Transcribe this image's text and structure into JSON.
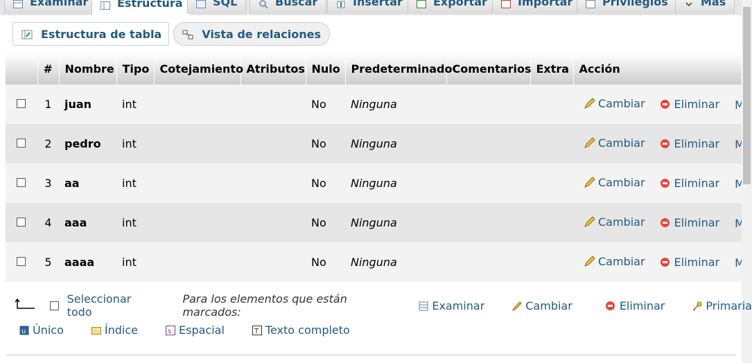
{
  "tabs": [
    {
      "label": "Examinar",
      "icon": "table-icon"
    },
    {
      "label": "Estructura",
      "icon": "structure-icon",
      "active": true
    },
    {
      "label": "SQL",
      "icon": "sql-icon"
    },
    {
      "label": "Buscar",
      "icon": "search-icon"
    },
    {
      "label": "Insertar",
      "icon": "insert-icon"
    },
    {
      "label": "Exportar",
      "icon": "export-icon"
    },
    {
      "label": "Importar",
      "icon": "import-icon"
    },
    {
      "label": "Privilegios",
      "icon": "privileges-icon"
    },
    {
      "label": "Más",
      "icon": "chevron-down-icon"
    }
  ],
  "subnav": {
    "table_structure": "Estructura de tabla",
    "relation_view": "Vista de relaciones"
  },
  "columns": [
    "",
    "#",
    "Nombre",
    "Tipo",
    "Cotejamiento",
    "Atributos",
    "Nulo",
    "Predeterminado",
    "Comentarios",
    "Extra",
    "Acción"
  ],
  "rows": [
    {
      "num": "1",
      "name": "juan",
      "type": "int",
      "collation": "",
      "attributes": "",
      "null": "No",
      "default": "Ninguna",
      "comments": "",
      "extra": ""
    },
    {
      "num": "2",
      "name": "pedro",
      "type": "int",
      "collation": "",
      "attributes": "",
      "null": "No",
      "default": "Ninguna",
      "comments": "",
      "extra": ""
    },
    {
      "num": "3",
      "name": "aa",
      "type": "int",
      "collation": "",
      "attributes": "",
      "null": "No",
      "default": "Ninguna",
      "comments": "",
      "extra": ""
    },
    {
      "num": "4",
      "name": "aaa",
      "type": "int",
      "collation": "",
      "attributes": "",
      "null": "No",
      "default": "Ninguna",
      "comments": "",
      "extra": ""
    },
    {
      "num": "5",
      "name": "aaaa",
      "type": "int",
      "collation": "",
      "attributes": "",
      "null": "No",
      "default": "Ninguna",
      "comments": "",
      "extra": ""
    }
  ],
  "row_actions": {
    "change": "Cambiar",
    "drop": "Eliminar",
    "more": "Más"
  },
  "footer": {
    "select_all": "Seleccionar todo",
    "with_selected": "Para los elementos que están marcados:",
    "browse": "Examinar",
    "change": "Cambiar",
    "drop": "Eliminar",
    "primary": "Primaria",
    "unique": "Único",
    "index": "Índice",
    "spatial": "Espacial",
    "fulltext": "Texto completo"
  },
  "colors": {
    "link": "#235a81",
    "drop_red": "#e8453c",
    "header_grad_end": "#cccccc"
  }
}
